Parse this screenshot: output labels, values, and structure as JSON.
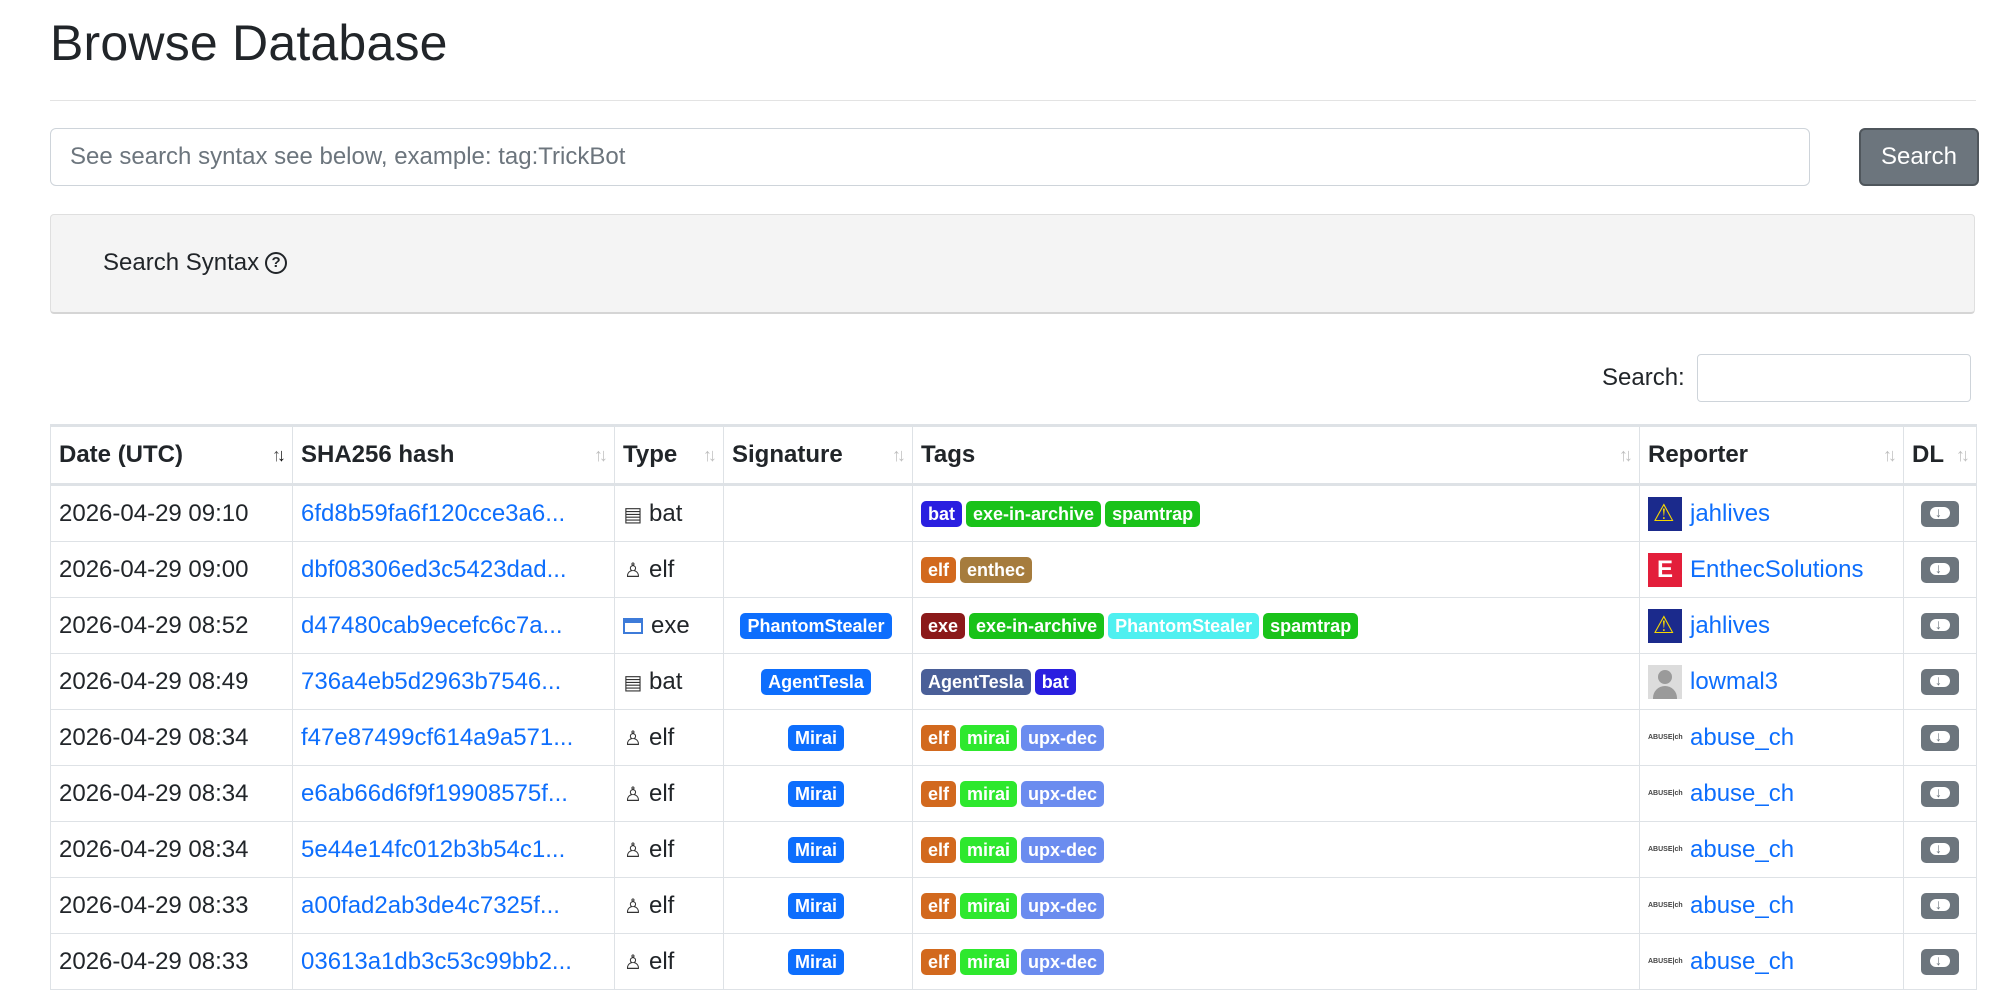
{
  "page": {
    "title": "Browse Database"
  },
  "search": {
    "placeholder": "See search syntax see below, example: tag:TrickBot",
    "button_label": "Search"
  },
  "syntax": {
    "label": "Search Syntax"
  },
  "filter": {
    "label": "Search:"
  },
  "table": {
    "headers": {
      "date": "Date (UTC)",
      "hash": "SHA256 hash",
      "type": "Type",
      "signature": "Signature",
      "tags": "Tags",
      "reporter": "Reporter",
      "dl": "DL"
    },
    "rows": [
      {
        "date": "2026-04-29 09:10",
        "hash": "6fd8b59fa6f120cce3a6...",
        "type_icon": "bat-file-icon",
        "type": "bat",
        "signature": "",
        "tags": [
          [
            "bat",
            "#2a1fe0"
          ],
          [
            "exe-in-archive",
            "#19c219"
          ],
          [
            "spamtrap",
            "#19c219"
          ]
        ],
        "reporter": "jahlives",
        "avatar": "jahlives"
      },
      {
        "date": "2026-04-29 09:00",
        "hash": "dbf08306ed3c5423dad...",
        "type_icon": "linux-penguin-icon",
        "type": "elf",
        "signature": "",
        "tags": [
          [
            "elf",
            "#d2691e"
          ],
          [
            "enthec",
            "#a67c3d"
          ]
        ],
        "reporter": "EnthecSolutions",
        "avatar": "enthec"
      },
      {
        "date": "2026-04-29 08:52",
        "hash": "d47480cab9ecefc6c7a...",
        "type_icon": "window-icon",
        "type": "exe",
        "signature": "PhantomStealer",
        "tags": [
          [
            "exe",
            "#8b1a1a"
          ],
          [
            "exe-in-archive",
            "#19c219"
          ],
          [
            "PhantomStealer",
            "#4ff0f0"
          ],
          [
            "spamtrap",
            "#19c219"
          ]
        ],
        "reporter": "jahlives",
        "avatar": "jahlives"
      },
      {
        "date": "2026-04-29 08:49",
        "hash": "736a4eb5d2963b7546...",
        "type_icon": "bat-file-icon",
        "type": "bat",
        "signature": "AgentTesla",
        "tags": [
          [
            "AgentTesla",
            "#4a5f98"
          ],
          [
            "bat",
            "#2a1fe0"
          ]
        ],
        "reporter": "lowmal3",
        "avatar": "lowmal"
      },
      {
        "date": "2026-04-29 08:34",
        "hash": "f47e87499cf614a9a571...",
        "type_icon": "linux-penguin-icon",
        "type": "elf",
        "signature": "Mirai",
        "tags": [
          [
            "elf",
            "#d2691e"
          ],
          [
            "mirai",
            "#2ee82e"
          ],
          [
            "upx-dec",
            "#6b8cef"
          ]
        ],
        "reporter": "abuse_ch",
        "avatar": "abuse"
      },
      {
        "date": "2026-04-29 08:34",
        "hash": "e6ab66d6f9f19908575f...",
        "type_icon": "linux-penguin-icon",
        "type": "elf",
        "signature": "Mirai",
        "tags": [
          [
            "elf",
            "#d2691e"
          ],
          [
            "mirai",
            "#2ee82e"
          ],
          [
            "upx-dec",
            "#6b8cef"
          ]
        ],
        "reporter": "abuse_ch",
        "avatar": "abuse"
      },
      {
        "date": "2026-04-29 08:34",
        "hash": "5e44e14fc012b3b54c1...",
        "type_icon": "linux-penguin-icon",
        "type": "elf",
        "signature": "Mirai",
        "tags": [
          [
            "elf",
            "#d2691e"
          ],
          [
            "mirai",
            "#2ee82e"
          ],
          [
            "upx-dec",
            "#6b8cef"
          ]
        ],
        "reporter": "abuse_ch",
        "avatar": "abuse"
      },
      {
        "date": "2026-04-29 08:33",
        "hash": "a00fad2ab3de4c7325f...",
        "type_icon": "linux-penguin-icon",
        "type": "elf",
        "signature": "Mirai",
        "tags": [
          [
            "elf",
            "#d2691e"
          ],
          [
            "mirai",
            "#2ee82e"
          ],
          [
            "upx-dec",
            "#6b8cef"
          ]
        ],
        "reporter": "abuse_ch",
        "avatar": "abuse"
      },
      {
        "date": "2026-04-29 08:33",
        "hash": "03613a1db3c53c99bb2...",
        "type_icon": "linux-penguin-icon",
        "type": "elf",
        "signature": "Mirai",
        "tags": [
          [
            "elf",
            "#d2691e"
          ],
          [
            "mirai",
            "#2ee82e"
          ],
          [
            "upx-dec",
            "#6b8cef"
          ]
        ],
        "reporter": "abuse_ch",
        "avatar": "abuse"
      }
    ]
  },
  "colors": {
    "signature_badge": "#0d6efd",
    "link": "#0d6efd",
    "search_button": "#6c757d"
  }
}
